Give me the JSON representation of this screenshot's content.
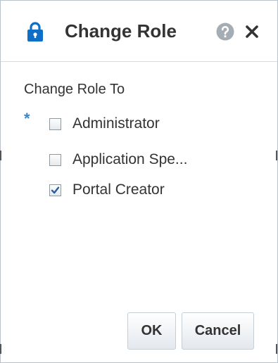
{
  "dialog": {
    "title": "Change Role",
    "icons": {
      "title_icon": "lock-icon",
      "help": "help-icon",
      "close": "close-icon"
    },
    "colors": {
      "lock": "#0f6fc6",
      "required": "#3a86c8",
      "help_bg": "#a4acb4"
    }
  },
  "form": {
    "section_label": "Change Role To",
    "required_marker": "*",
    "options": [
      {
        "label": "Administrator",
        "checked": false
      },
      {
        "label": "Application Spe...",
        "checked": false
      },
      {
        "label": "Portal Creator",
        "checked": true
      }
    ]
  },
  "buttons": {
    "ok_label": "OK",
    "cancel_label": "Cancel"
  }
}
